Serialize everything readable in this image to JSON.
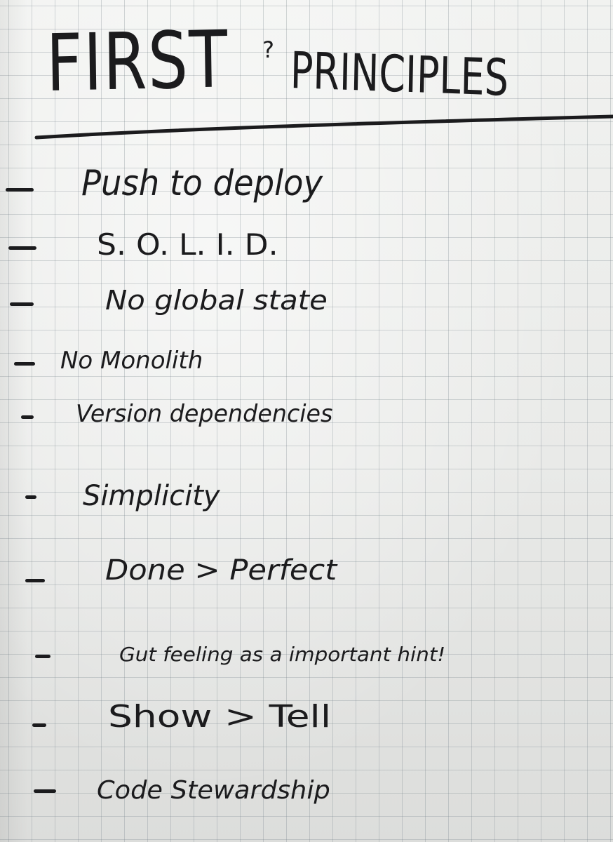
{
  "title": {
    "first": "FIRST",
    "question_mark": "?",
    "principles": "PRINCIPLES"
  },
  "items": [
    "Push to deploy",
    "S. O. L. I. D.",
    "No global state",
    "No Monolith",
    "Version dependencies",
    "Simplicity",
    "Done > Perfect",
    "Gut feeling as a important hint!",
    "Show > Tell",
    "Code Stewardship"
  ],
  "colors": {
    "ink": "#1b1b1d",
    "paper": "#ecedeb",
    "grid": "#8a959c"
  }
}
